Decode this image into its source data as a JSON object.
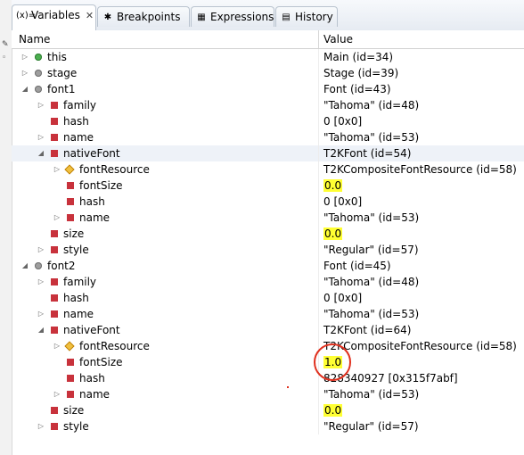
{
  "tabs": [
    {
      "label": "Variables",
      "icon": "variables-icon",
      "active": true,
      "closable": true
    },
    {
      "label": "Breakpoints",
      "icon": "breakpoints-icon",
      "active": false
    },
    {
      "label": "Expressions",
      "icon": "expressions-icon",
      "active": false
    },
    {
      "label": "History",
      "icon": "history-icon",
      "active": false
    }
  ],
  "columns": {
    "name": "Name",
    "value": "Value"
  },
  "rows": [
    {
      "level": 0,
      "twisty": "collapsed",
      "icon": "field-public-icon",
      "name": "this",
      "value": "Main  (id=34)"
    },
    {
      "level": 0,
      "twisty": "collapsed",
      "icon": "field-default-icon",
      "name": "stage",
      "value": "Stage  (id=39)"
    },
    {
      "level": 0,
      "twisty": "expanded",
      "icon": "field-default-icon",
      "name": "font1",
      "value": "Font  (id=43)"
    },
    {
      "level": 1,
      "twisty": "collapsed",
      "icon": "field-private-icon",
      "name": "family",
      "value": "\"Tahoma\" (id=48)"
    },
    {
      "level": 1,
      "twisty": "none",
      "icon": "field-private-icon",
      "name": "hash",
      "value": "0 [0x0]"
    },
    {
      "level": 1,
      "twisty": "collapsed",
      "icon": "field-private-icon",
      "name": "name",
      "value": "\"Tahoma\" (id=53)"
    },
    {
      "level": 1,
      "twisty": "expanded",
      "icon": "field-private-icon",
      "name": "nativeFont",
      "value": "T2KFont  (id=54)",
      "selected": true
    },
    {
      "level": 2,
      "twisty": "collapsed",
      "icon": "field-protected-icon",
      "name": "fontResource",
      "value": "T2KCompositeFontResource  (id=58)"
    },
    {
      "level": 2,
      "twisty": "none",
      "icon": "field-private-icon",
      "name": "fontSize",
      "value": "0.0",
      "highlight": true
    },
    {
      "level": 2,
      "twisty": "none",
      "icon": "field-private-icon",
      "name": "hash",
      "value": "0 [0x0]"
    },
    {
      "level": 2,
      "twisty": "collapsed",
      "icon": "field-private-icon",
      "name": "name",
      "value": "\"Tahoma\" (id=53)"
    },
    {
      "level": 1,
      "twisty": "none",
      "icon": "field-private-icon",
      "name": "size",
      "value": "0.0",
      "highlight": true
    },
    {
      "level": 1,
      "twisty": "collapsed",
      "icon": "field-private-icon",
      "name": "style",
      "value": "\"Regular\" (id=57)"
    },
    {
      "level": 0,
      "twisty": "expanded",
      "icon": "field-default-icon",
      "name": "font2",
      "value": "Font  (id=45)"
    },
    {
      "level": 1,
      "twisty": "collapsed",
      "icon": "field-private-icon",
      "name": "family",
      "value": "\"Tahoma\" (id=48)"
    },
    {
      "level": 1,
      "twisty": "none",
      "icon": "field-private-icon",
      "name": "hash",
      "value": "0 [0x0]"
    },
    {
      "level": 1,
      "twisty": "collapsed",
      "icon": "field-private-icon",
      "name": "name",
      "value": "\"Tahoma\" (id=53)"
    },
    {
      "level": 1,
      "twisty": "expanded",
      "icon": "field-private-icon",
      "name": "nativeFont",
      "value": "T2KFont  (id=64)"
    },
    {
      "level": 2,
      "twisty": "collapsed",
      "icon": "field-protected-icon",
      "name": "fontResource",
      "value": "T2KCompositeFontResource  (id=58)"
    },
    {
      "level": 2,
      "twisty": "none",
      "icon": "field-private-icon",
      "name": "fontSize",
      "value": "1.0",
      "highlight": true
    },
    {
      "level": 2,
      "twisty": "none",
      "icon": "field-private-icon",
      "name": "hash",
      "value": "828340927 [0x315f7abf]"
    },
    {
      "level": 2,
      "twisty": "collapsed",
      "icon": "field-private-icon",
      "name": "name",
      "value": "\"Tahoma\" (id=53)"
    },
    {
      "level": 1,
      "twisty": "none",
      "icon": "field-private-icon",
      "name": "size",
      "value": "0.0",
      "highlight": true
    },
    {
      "level": 1,
      "twisty": "collapsed",
      "icon": "field-private-icon",
      "name": "style",
      "value": "\"Regular\" (id=57)"
    }
  ],
  "colors": {
    "highlight": "#ffff33",
    "annotation": "#e0301e",
    "private_field": "#c8323c"
  }
}
